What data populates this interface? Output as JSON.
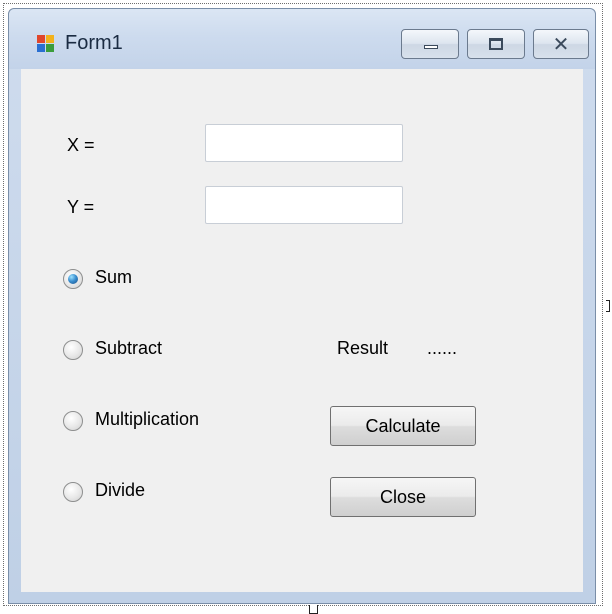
{
  "window": {
    "title": "Form1",
    "close_glyph": "✕"
  },
  "inputs": {
    "x_label": "X =",
    "x_value": "",
    "y_label": "Y =",
    "y_value": ""
  },
  "operations": [
    {
      "label": "Sum",
      "checked": true
    },
    {
      "label": "Subtract",
      "checked": false
    },
    {
      "label": "Multiplication",
      "checked": false
    },
    {
      "label": "Divide",
      "checked": false
    }
  ],
  "result": {
    "label": "Result",
    "value": "......"
  },
  "buttons": {
    "calculate": "Calculate",
    "close": "Close"
  },
  "icons": {
    "app": "app-window-icon",
    "minimize": "minimize-icon",
    "maximize": "maximize-icon",
    "close": "close-icon"
  },
  "colors": {
    "client_background": "#f0f0f0",
    "titlebar": "#cddbee",
    "radio_selected": "#3a8fd0"
  }
}
